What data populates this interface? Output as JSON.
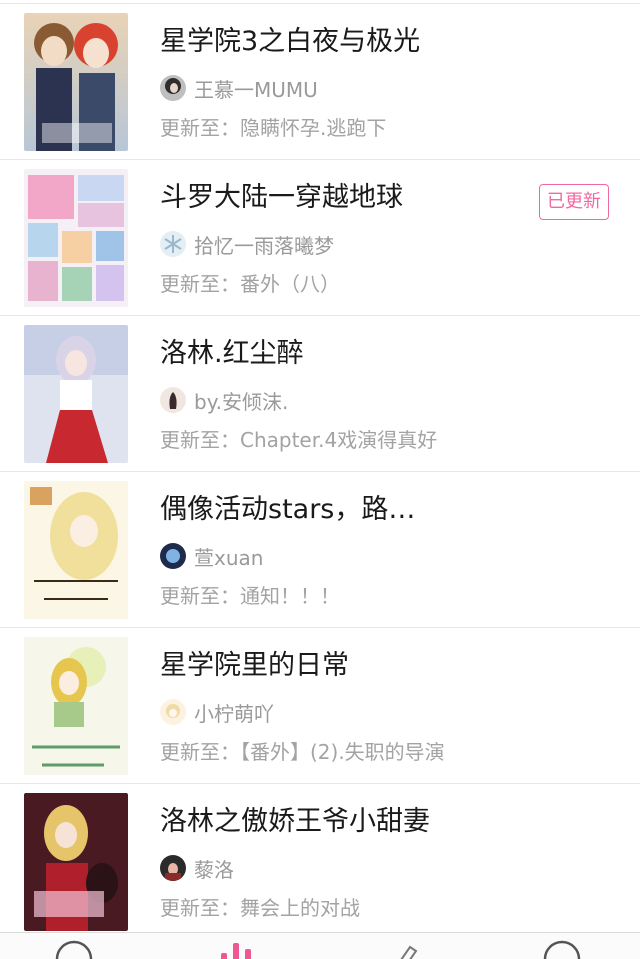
{
  "stories": [
    {
      "title": "星学院3之白夜与极光",
      "author": "王慕一MUMU",
      "update": "更新至：隐瞒怀孕.逃跑下",
      "badge": "",
      "cover_icon": "anime-couple-cover",
      "avatar_icon": "dark-hair-avatar"
    },
    {
      "title": "斗罗大陆一穿越地球",
      "author": "拾忆一雨落曦梦",
      "update": "更新至：番外（八）",
      "badge": "已更新",
      "cover_icon": "collage-cover",
      "avatar_icon": "snowflake-avatar"
    },
    {
      "title": "洛林.红尘醉",
      "author": "by.安倾沫.",
      "update": "更新至：Chapter.4戏演得真好",
      "badge": "",
      "cover_icon": "red-dress-girl-cover",
      "avatar_icon": "silhouette-avatar"
    },
    {
      "title": "偶像活动stars，路…",
      "author": "萱xuan",
      "update": "更新至：通知！！！",
      "badge": "",
      "cover_icon": "blonde-idol-cover",
      "avatar_icon": "blue-orb-avatar"
    },
    {
      "title": "星学院里的日常",
      "author": "小柠萌吖",
      "update": "更新至：【番外】(2).失职的导演",
      "badge": "",
      "cover_icon": "green-title-cover",
      "avatar_icon": "cream-chibi-avatar"
    },
    {
      "title": "洛林之傲娇王爷小甜妻",
      "author": "藜洛",
      "update": "更新至：舞会上的对战",
      "badge": "",
      "cover_icon": "crimson-cover",
      "avatar_icon": "dark-portrait-avatar"
    }
  ],
  "tabbar": {
    "tabs": [
      "home-circle-icon",
      "chart-bars-icon",
      "pen-icon",
      "profile-circle-icon"
    ],
    "active_color": "#f0568f"
  },
  "colors": {
    "badge": "#f06aa0",
    "title": "#1a1a1a",
    "meta": "#9a9a9a"
  }
}
